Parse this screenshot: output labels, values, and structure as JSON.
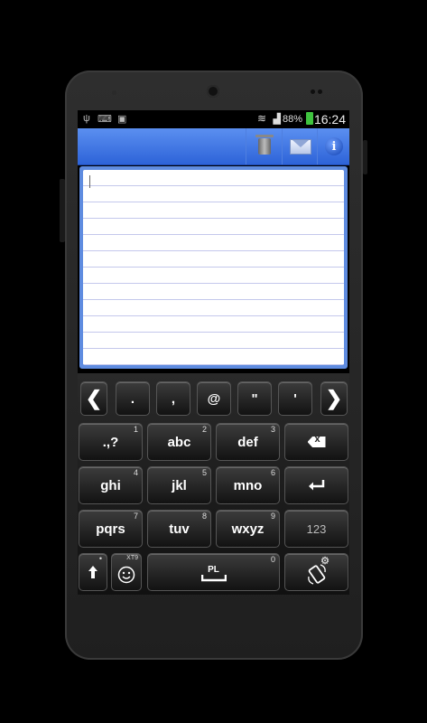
{
  "status_bar": {
    "battery": "88%",
    "time": "16:24"
  },
  "app_bar": {
    "actions": [
      "trash-icon",
      "mail-icon",
      "info-icon"
    ],
    "info_glyph": "i"
  },
  "keyboard": {
    "row_punct": [
      ".",
      ",",
      "@",
      "\"",
      "'"
    ],
    "nav": {
      "left": "❮",
      "right": "❯"
    },
    "keys": [
      {
        "label": ".,?",
        "num": "1"
      },
      {
        "label": "abc",
        "num": "2"
      },
      {
        "label": "def",
        "num": "3"
      },
      {
        "label": "ghi",
        "num": "4"
      },
      {
        "label": "jkl",
        "num": "5"
      },
      {
        "label": "mno",
        "num": "6"
      },
      {
        "label": "pqrs",
        "num": "7"
      },
      {
        "label": "tuv",
        "num": "8"
      },
      {
        "label": "wxyz",
        "num": "9"
      }
    ],
    "mode_label": "123",
    "space": {
      "label": "PL",
      "num": "0"
    },
    "shift_dot": "•",
    "xt9": "XT9"
  }
}
